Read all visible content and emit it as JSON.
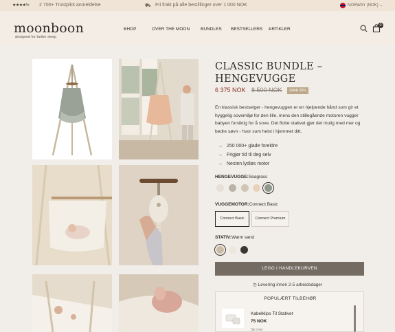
{
  "topbar": {
    "stars": "★★★★½",
    "trustpilot": "2 700+ Trustpilot anmeldelse",
    "shipping": "Fri frakt på alle bestillinger over 1 000 NOK",
    "region": "NORWAY (NOK)",
    "region_chevron": "chevron-down-icon"
  },
  "header": {
    "logo": "moonboon",
    "tagline": "designed for better sleep",
    "nav": [
      "SHOP",
      "OVER THE MOON",
      "BUNDLES",
      "BESTSELLERS",
      "ARTIKLER"
    ],
    "cart_count": "0"
  },
  "product": {
    "title": "CLASSIC BUNDLE – HENGEVUGGE",
    "price": "6 375 NOK",
    "old_price": "8 500 NOK",
    "save_badge": "SPAR 25%",
    "description": "En klassisk bestselger - hengevuggen er en hjelpende hånd som gir et hyggelig sovemiljø for den lille, mens den stillegående motoren vugger babyen forsiktig for å sove. Det flotte stativet gjør det mulig med mer og bedre søvn - hvor som helst i hjemmet ditt.",
    "usps": [
      "250 000+ glade foreldre",
      "Frigjør tid til deg selv",
      "Nesten lydløs motor"
    ],
    "hengevugge": {
      "label": "HENGEVUGGE:",
      "value": "Seagrass",
      "swatches": [
        "#e6e0d8",
        "#b9b3aa",
        "#cfc4b6",
        "#e9d2bd",
        "#8f998d"
      ],
      "selected": 4
    },
    "motor": {
      "label": "VUGGEMOTOR:",
      "value": "Connect Basic",
      "options": [
        "Connect Basic",
        "Connect Premium"
      ],
      "selected": 0
    },
    "stativ": {
      "label": "STATIV:",
      "value": "Warm sand",
      "swatches": [
        "#cbbba6",
        "#ece6dd",
        "#3a3835"
      ],
      "selected": 0
    },
    "cart_button": "LEGG I HANDLEKURVEN",
    "delivery": "Levering innen 2-5 arbeidsdager"
  },
  "popular": {
    "title": "POPULÆRT TILBEHØR",
    "item_name": "Kabelklips Til Stativet",
    "item_price": "75 NOK",
    "more": "Se mer"
  },
  "colors": {
    "accent": "#746b62",
    "price": "#8a2a1e",
    "background": "#f1eee9",
    "topbar": "#efe4d6"
  }
}
